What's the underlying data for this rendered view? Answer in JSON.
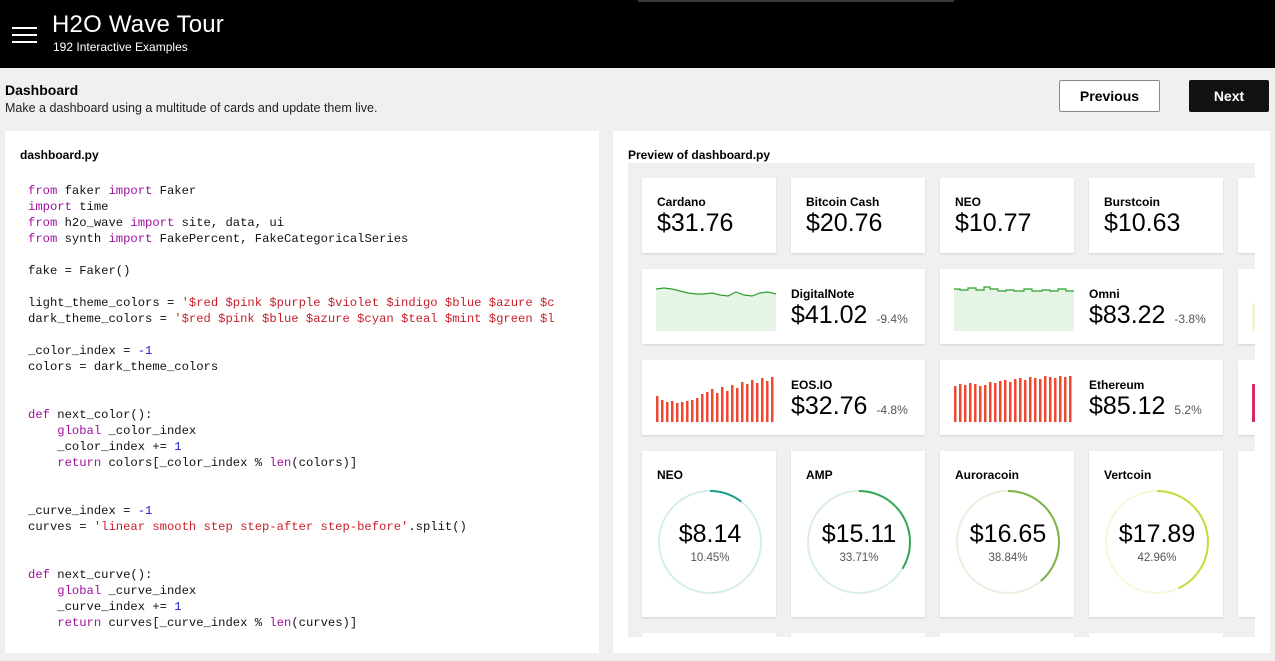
{
  "header": {
    "title": "H2O Wave Tour",
    "subtitle": "192 Interactive Examples",
    "menu_icon": "hamburger-icon"
  },
  "page": {
    "title": "Dashboard",
    "description": "Make a dashboard using a multitude of cards and update them live.",
    "previous_label": "Previous",
    "next_label": "Next"
  },
  "code_panel": {
    "filename": "dashboard.py"
  },
  "preview_panel": {
    "label": "Preview of dashboard.py"
  },
  "colors": {
    "green_spark": "#2ca02c",
    "green_fill": "#e6f4e6",
    "bar_red": "#ee4a32",
    "keyword": "#a0109f",
    "string": "#c8202a",
    "number": "#1a1ac8"
  },
  "stat_cards": [
    {
      "title": "Cardano",
      "value": "$31.76"
    },
    {
      "title": "Bitcoin Cash",
      "value": "$20.76"
    },
    {
      "title": "NEO",
      "value": "$10.77"
    },
    {
      "title": "Burstcoin",
      "value": "$10.63"
    }
  ],
  "line_cards": [
    {
      "title": "DigitalNote",
      "value": "$41.02",
      "change": "-9.4%"
    },
    {
      "title": "Omni",
      "value": "$83.22",
      "change": "-3.8%"
    }
  ],
  "bar_cards": [
    {
      "title": "EOS.IO",
      "value": "$32.76",
      "change": "-4.8%"
    },
    {
      "title": "Ethereum",
      "value": "$85.12",
      "change": "5.2%"
    }
  ],
  "ring_cards": [
    {
      "title": "NEO",
      "value": "$8.14",
      "percent": "10.45%",
      "fraction": 0.1045,
      "color": "#1a9e8a"
    },
    {
      "title": "AMP",
      "value": "$15.11",
      "percent": "33.71%",
      "fraction": 0.3371,
      "color": "#34a853"
    },
    {
      "title": "Auroracoin",
      "value": "$16.65",
      "percent": "38.84%",
      "fraction": 0.3884,
      "color": "#7cb342"
    },
    {
      "title": "Vertcoin",
      "value": "$17.89",
      "percent": "42.96%",
      "fraction": 0.4296,
      "color": "#c6dc3a"
    }
  ]
}
